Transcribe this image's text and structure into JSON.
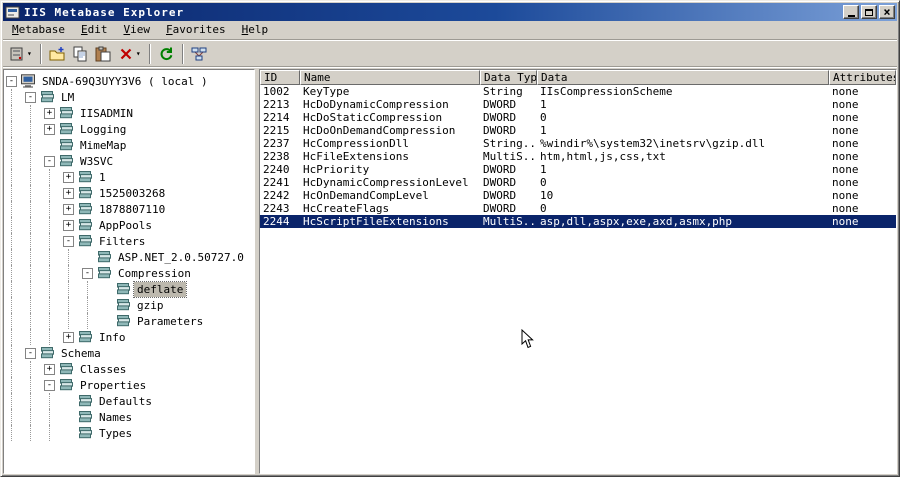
{
  "window": {
    "title": "IIS Metabase Explorer",
    "controls": [
      {
        "name": "minimize"
      },
      {
        "name": "maximize"
      },
      {
        "name": "close"
      }
    ]
  },
  "menu": {
    "items": [
      {
        "label": "Metabase"
      },
      {
        "label": "Edit"
      },
      {
        "label": "View"
      },
      {
        "label": "Favorites"
      },
      {
        "label": "Help"
      }
    ]
  },
  "toolbar": {
    "buttons": [
      {
        "name": "connect-server",
        "icon": "server-icon",
        "dropdown": true
      },
      {
        "divider": true
      },
      {
        "name": "new-key",
        "icon": "new-key-icon"
      },
      {
        "name": "copy-key",
        "icon": "copy-icon"
      },
      {
        "name": "paste-key",
        "icon": "paste-icon"
      },
      {
        "name": "delete-key",
        "icon": "delete-icon",
        "dropdown": true
      },
      {
        "divider": true
      },
      {
        "name": "refresh",
        "icon": "refresh-icon"
      },
      {
        "divider": true
      },
      {
        "name": "connections",
        "icon": "network-icon"
      }
    ]
  },
  "tree": {
    "items": [
      {
        "label": "SNDA-69Q3UYY3V6 ( local )",
        "level": 0,
        "expand": "minus",
        "icon": "computer"
      },
      {
        "label": "LM",
        "level": 1,
        "expand": "minus",
        "icon": "node"
      },
      {
        "label": "IISADMIN",
        "level": 2,
        "expand": "plus",
        "icon": "node"
      },
      {
        "label": "Logging",
        "level": 2,
        "expand": "plus",
        "icon": "node"
      },
      {
        "label": "MimeMap",
        "level": 2,
        "expand": "none",
        "icon": "node"
      },
      {
        "label": "W3SVC",
        "level": 2,
        "expand": "minus",
        "icon": "node"
      },
      {
        "label": "1",
        "level": 3,
        "expand": "plus",
        "icon": "node"
      },
      {
        "label": "1525003268",
        "level": 3,
        "expand": "plus",
        "icon": "node"
      },
      {
        "label": "1878807110",
        "level": 3,
        "expand": "plus",
        "icon": "node"
      },
      {
        "label": "AppPools",
        "level": 3,
        "expand": "plus",
        "icon": "node"
      },
      {
        "label": "Filters",
        "level": 3,
        "expand": "minus",
        "icon": "node"
      },
      {
        "label": "ASP.NET_2.0.50727.0",
        "level": 4,
        "expand": "none",
        "icon": "node"
      },
      {
        "label": "Compression",
        "level": 4,
        "expand": "minus",
        "icon": "node"
      },
      {
        "label": "deflate",
        "level": 5,
        "expand": "none",
        "icon": "node",
        "selected": true
      },
      {
        "label": "gzip",
        "level": 5,
        "expand": "none",
        "icon": "node"
      },
      {
        "label": "Parameters",
        "level": 5,
        "expand": "none",
        "icon": "node"
      },
      {
        "label": "Info",
        "level": 3,
        "expand": "plus",
        "icon": "node"
      },
      {
        "label": "Schema",
        "level": 1,
        "expand": "minus",
        "icon": "node"
      },
      {
        "label": "Classes",
        "level": 2,
        "expand": "plus",
        "icon": "node"
      },
      {
        "label": "Properties",
        "level": 2,
        "expand": "minus",
        "icon": "node"
      },
      {
        "label": "Defaults",
        "level": 3,
        "expand": "none",
        "icon": "node"
      },
      {
        "label": "Names",
        "level": 3,
        "expand": "none",
        "icon": "node"
      },
      {
        "label": "Types",
        "level": 3,
        "expand": "none",
        "icon": "node"
      }
    ]
  },
  "table": {
    "columns": [
      "ID",
      "Name",
      "Data Type",
      "Data",
      "Attributes"
    ],
    "rows": [
      [
        "1002",
        "KeyType",
        "String",
        "IIsCompressionScheme",
        "none"
      ],
      [
        "2213",
        "HcDoDynamicCompression",
        "DWORD",
        "1",
        "none"
      ],
      [
        "2214",
        "HcDoStaticCompression",
        "DWORD",
        "0",
        "none"
      ],
      [
        "2215",
        "HcDoOnDemandCompression",
        "DWORD",
        "1",
        "none"
      ],
      [
        "2237",
        "HcCompressionDll",
        "String...",
        "%windir%\\system32\\inetsrv\\gzip.dll",
        "none"
      ],
      [
        "2238",
        "HcFileExtensions",
        "MultiS...",
        "htm,html,js,css,txt",
        "none"
      ],
      [
        "2240",
        "HcPriority",
        "DWORD",
        "1",
        "none"
      ],
      [
        "2241",
        "HcDynamicCompressionLevel",
        "DWORD",
        "0",
        "none"
      ],
      [
        "2242",
        "HcOnDemandCompLevel",
        "DWORD",
        "10",
        "none"
      ],
      [
        "2243",
        "HcCreateFlags",
        "DWORD",
        "0",
        "none"
      ],
      [
        "2244",
        "HcScriptFileExtensions",
        "MultiS...",
        "asp,dll,aspx,exe,axd,asmx,php",
        "none"
      ]
    ],
    "selected_row_index": 10
  },
  "colors": {
    "titlebar_start": "#0a246a",
    "titlebar_end": "#7ba0d8",
    "chrome": "#d4d0c8",
    "selection": "#0a246a",
    "inactive_selection": "#bdb9ae"
  }
}
